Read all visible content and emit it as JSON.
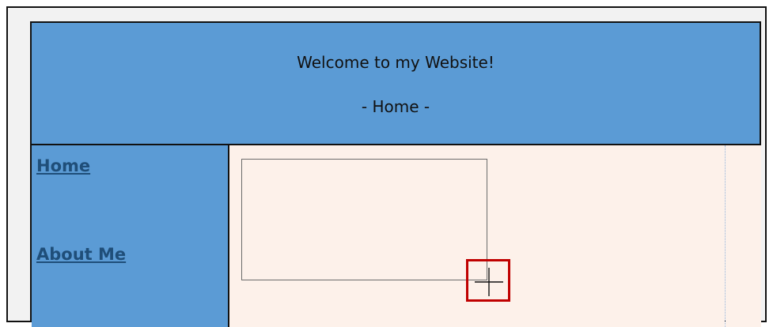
{
  "header": {
    "title": "Welcome to my Website!",
    "subtitle": "- Home -"
  },
  "sidebar": {
    "items": [
      {
        "label": "Home"
      },
      {
        "label": "About Me"
      }
    ]
  },
  "colors": {
    "header_bg": "#5b9bd5",
    "sidebar_bg": "#5b9bd5",
    "content_bg": "#fdf1ea",
    "link": "#1f4e79",
    "highlight": "#c00000"
  },
  "icons": {
    "cursor": "crosshair-icon"
  }
}
